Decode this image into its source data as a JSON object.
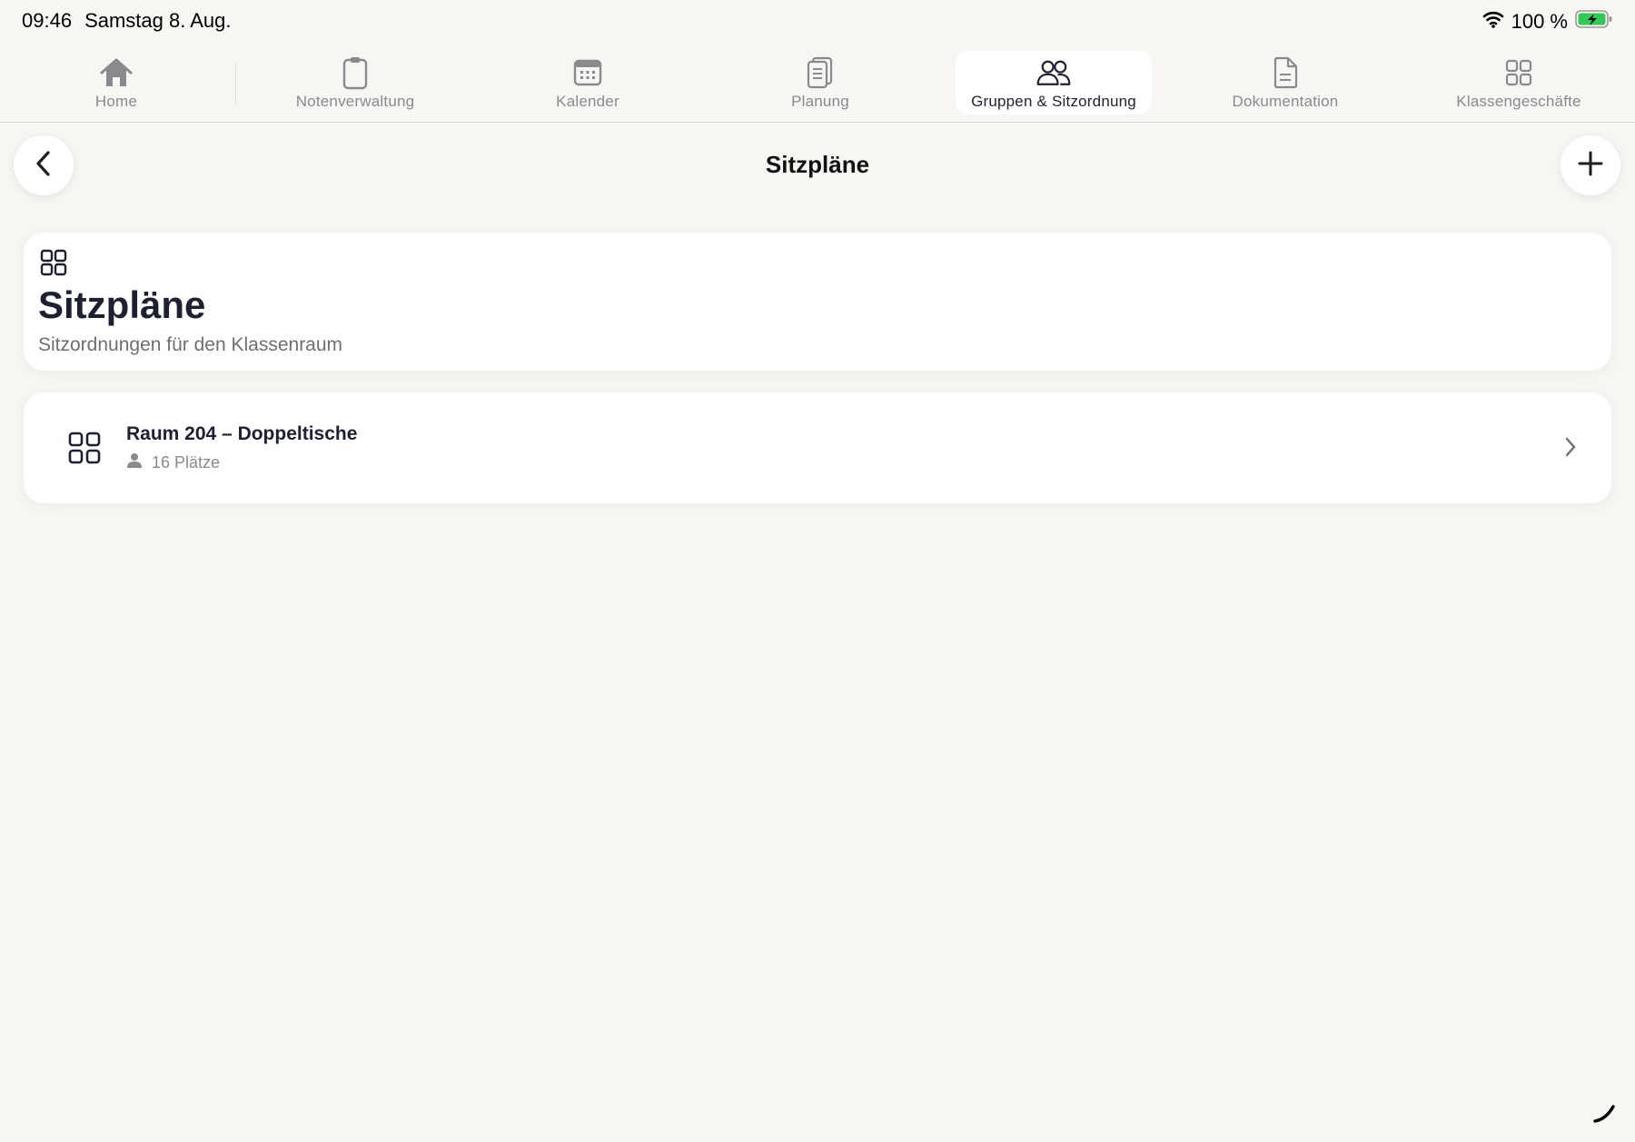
{
  "status": {
    "time": "09:46",
    "date": "Samstag 8. Aug.",
    "battery": "100 %",
    "icons": [
      "wifi-icon",
      "battery-charging-icon"
    ]
  },
  "tabs": [
    {
      "label": "Home",
      "icon": "home-icon",
      "active": false
    },
    {
      "label": "Notenverwaltung",
      "icon": "clipboard-icon",
      "active": false
    },
    {
      "label": "Kalender",
      "icon": "calendar-icon",
      "active": false
    },
    {
      "label": "Planung",
      "icon": "document-pages-icon",
      "active": false
    },
    {
      "label": "Gruppen & Sitzordnung",
      "icon": "people-icon",
      "active": true
    },
    {
      "label": "Dokumentation",
      "icon": "document-icon",
      "active": false
    },
    {
      "label": "Klassengeschäfte",
      "icon": "grid-icon",
      "active": false
    }
  ],
  "nav": {
    "title": "Sitzpläne",
    "back_icon": "chevron-left-icon",
    "add_icon": "plus-icon"
  },
  "header": {
    "icon": "grid-icon",
    "title": "Sitzpläne",
    "subtitle": "Sitzordnungen für den Klassenraum"
  },
  "seating_plans": [
    {
      "title": "Raum 204 – Doppeltische",
      "seats": "16 Plätze",
      "icon": "grid-icon",
      "meta_icon": "person-icon"
    }
  ],
  "colors": {
    "background": "#f7f6f3",
    "card": "#ffffff",
    "accent_dark": "#1d2030",
    "muted": "#8a8a8e",
    "battery_green": "#34c759"
  }
}
